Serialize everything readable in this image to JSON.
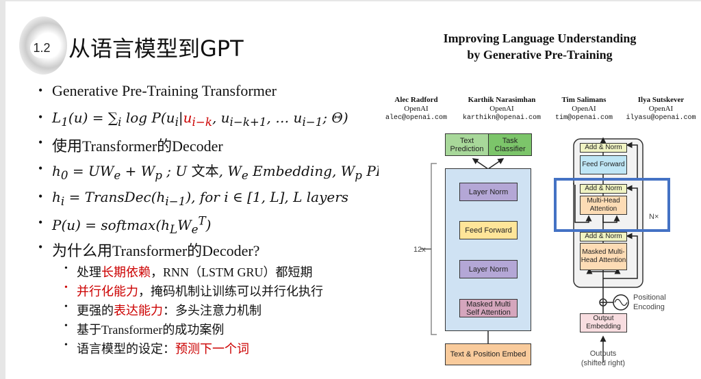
{
  "slide": {
    "section_number": "1.2",
    "title": "从语言模型到GPT",
    "bullets": [
      "Generative Pre-Training Transformer",
      {
        "pre": "L",
        "sub1": "1",
        "mid": "(u) = ∑",
        "subi": "i",
        "log": " log P(u",
        "subi2": "i",
        "bar": "|",
        "red": "u",
        "redsub": "i−k",
        "rest": ", u",
        "sub3": "i−k+1",
        "rest2": ", … u",
        "sub4": "i−1",
        "end": "; Θ)"
      },
      "使用Transformer的Decoder",
      {
        "a": "h",
        "as": "0",
        "b": " = UW",
        "bs": "e",
        "c": " + W",
        "cs": "p",
        "d": " ; U ",
        "e": "文本",
        "f": ", W",
        "fs": "e",
        "g": " Embedding, W",
        "gs": "p",
        "h": " PE"
      },
      {
        "a": "h",
        "as": "i",
        "b": " = TransDec(h",
        "bs": "i−1",
        "c": "), for i ∈ [1, L], L layers"
      },
      {
        "a": "P(u) = softmax(h",
        "as": "L",
        "b": "W",
        "bs": "e",
        "bsup": "T",
        "c": ")"
      },
      "为什么用Transformer的Decoder?"
    ],
    "sub_bullets": [
      {
        "pre": "处理",
        "red": "长期依赖",
        "post": "，RNN（LSTM GRU）都短期"
      },
      {
        "pre": "",
        "red": "并行化能力",
        "post": "，掩码机制让训练可以并行化执行"
      },
      {
        "pre": "更强的",
        "red": "表达能力",
        "post": "：多头注意力机制"
      },
      {
        "pre": "基于Transformer的成功案例",
        "red": "",
        "post": ""
      },
      {
        "pre": "语言模型的设定：",
        "red": "预测下一个词",
        "post": ""
      }
    ]
  },
  "paper": {
    "title_line1": "Improving Language Understanding",
    "title_line2": "by Generative Pre-Training",
    "authors": [
      {
        "name": "Alec Radford",
        "org": "OpenAI",
        "email": "alec@openai.com"
      },
      {
        "name": "Karthik Narasimhan",
        "org": "OpenAI",
        "email": "karthikn@openai.com"
      },
      {
        "name": "Tim Salimans",
        "org": "OpenAI",
        "email": "tim@openai.com"
      },
      {
        "name": "Ilya Sutskever",
        "org": "OpenAI",
        "email": "ilyasu@openai.com"
      }
    ],
    "gpt": {
      "text_prediction": "Text Prediction",
      "task_classifier": "Task Classifier",
      "layer_norm": "Layer Norm",
      "feed_forward": "Feed Forward",
      "masked_attn": "Masked Multi Self Attention",
      "embed": "Text & Position Embed",
      "repeat": "12x"
    },
    "transformer": {
      "add_norm": "Add & Norm",
      "feed_forward": "Feed Forward",
      "mha": "Multi-Head Attention",
      "masked_mha": "Masked Multi-Head Attention",
      "pos1": "Positional",
      "pos2": "Encoding",
      "out_emb": "Output Embedding",
      "outputs1": "Outputs",
      "outputs2": "(shifted right)",
      "repeat": "N×"
    },
    "highlight_color": "#4472c4"
  }
}
